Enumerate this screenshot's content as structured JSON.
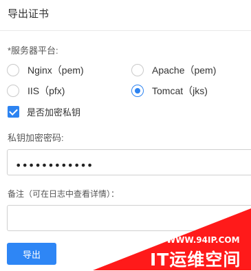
{
  "header": {
    "title": "导出证书"
  },
  "platform": {
    "label": "*服务器平台:",
    "options": [
      {
        "label": "Nginx（pem)",
        "checked": false
      },
      {
        "label": "Apache（pem)",
        "checked": false
      },
      {
        "label": "IIS（pfx)",
        "checked": false
      },
      {
        "label": "Tomcat（jks)",
        "checked": true
      }
    ]
  },
  "encrypt_private_key": {
    "label": "是否加密私钥",
    "checked": true
  },
  "private_key_password": {
    "label": "私钥加密密码:",
    "value": "••••••••••••"
  },
  "remark": {
    "label": "备注（可在日志中查看详情）：",
    "value": ""
  },
  "export_button": {
    "label": "导出"
  },
  "watermark": {
    "url": "WWW.94IP.COM",
    "name": "IT运维空间"
  },
  "colors": {
    "accent": "#2c83f1",
    "watermark": "#ff1a1a"
  }
}
